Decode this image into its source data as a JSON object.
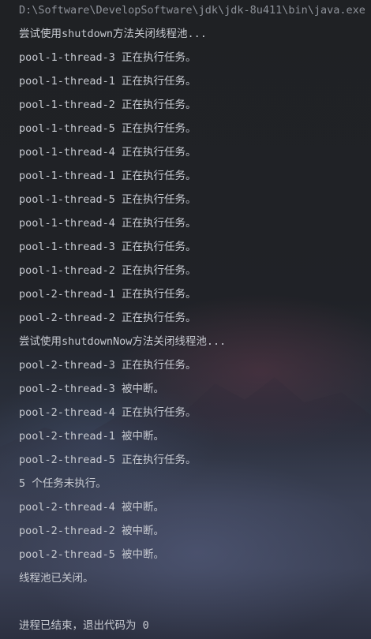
{
  "console": {
    "command_line": "D:\\Software\\DevelopSoftware\\jdk\\jdk-8u411\\bin\\java.exe ...",
    "lines": [
      "尝试使用shutdown方法关闭线程池...",
      "pool-1-thread-3 正在执行任务。",
      "pool-1-thread-1 正在执行任务。",
      "pool-1-thread-2 正在执行任务。",
      "pool-1-thread-5 正在执行任务。",
      "pool-1-thread-4 正在执行任务。",
      "pool-1-thread-1 正在执行任务。",
      "pool-1-thread-5 正在执行任务。",
      "pool-1-thread-4 正在执行任务。",
      "pool-1-thread-3 正在执行任务。",
      "pool-1-thread-2 正在执行任务。",
      "pool-2-thread-1 正在执行任务。",
      "pool-2-thread-2 正在执行任务。",
      "尝试使用shutdownNow方法关闭线程池...",
      "pool-2-thread-3 正在执行任务。",
      "pool-2-thread-3 被中断。",
      "pool-2-thread-4 正在执行任务。",
      "pool-2-thread-1 被中断。",
      "pool-2-thread-5 正在执行任务。",
      "5 个任务未执行。",
      "pool-2-thread-4 被中断。",
      "pool-2-thread-2 被中断。",
      "pool-2-thread-5 被中断。",
      "线程池已关闭。"
    ],
    "exit_message": "进程已结束，退出代码为 0"
  }
}
